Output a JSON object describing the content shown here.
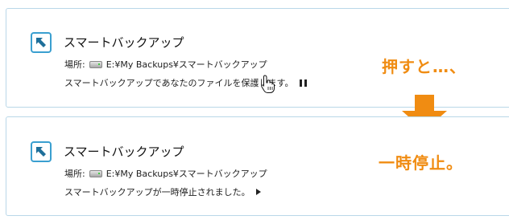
{
  "cards": [
    {
      "title": "スマートバックアップ",
      "location_label": "場所:",
      "location_path": "E:¥My Backups¥スマートバックアップ",
      "status_text": "スマートバックアップであなたのファイルを保護します。",
      "control_icon": "pause-icon"
    },
    {
      "title": "スマートバックアップ",
      "location_label": "場所:",
      "location_path": "E:¥My Backups¥スマートバックアップ",
      "status_text": "スマートバックアップが一時停止されました。",
      "control_icon": "play-icon"
    }
  ],
  "annotations": {
    "press": "押すと…、",
    "paused": "一時停止。",
    "color": "#f08c12"
  },
  "icons": {
    "app": "backup-arrow-icon",
    "drive": "drive-icon",
    "cursor": "hand-cursor-icon"
  },
  "colors": {
    "card_border": "#b9d7e8",
    "icon_blue": "#3a9fd0"
  }
}
